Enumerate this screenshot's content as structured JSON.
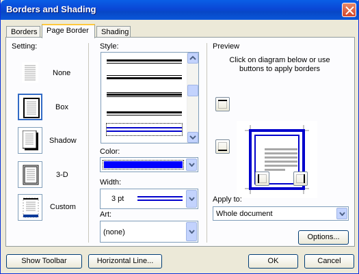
{
  "window": {
    "title": "Borders and Shading"
  },
  "tabs": [
    {
      "label": "Borders",
      "active": false
    },
    {
      "label": "Page Border",
      "active": true
    },
    {
      "label": "Shading",
      "active": false
    }
  ],
  "setting": {
    "label": "Setting:",
    "options": [
      {
        "label": "None",
        "icon": "page-none-icon",
        "selected": false
      },
      {
        "label": "Box",
        "icon": "page-box-icon",
        "selected": true
      },
      {
        "label": "Shadow",
        "icon": "page-shadow-icon",
        "selected": false
      },
      {
        "label": "3-D",
        "icon": "page-3d-icon",
        "selected": false
      },
      {
        "label": "Custom",
        "icon": "page-custom-icon",
        "selected": false
      }
    ]
  },
  "style": {
    "label": "Style:",
    "items": [
      "thick-thin double",
      "thin-thick double",
      "thick-thin-thick triple",
      "thick-thin double",
      "thin-thin double (blue, selected)"
    ]
  },
  "color": {
    "label": "Color:",
    "value_color": "#0000ff"
  },
  "width": {
    "label": "Width:",
    "value": "3 pt"
  },
  "art": {
    "label": "Art:",
    "value": "(none)"
  },
  "preview": {
    "label": "Preview",
    "hint": "Click on diagram below or use buttons to apply borders",
    "border_color": "#0000cc"
  },
  "apply_to": {
    "label": "Apply to:",
    "value": "Whole document"
  },
  "buttons": {
    "options": "Options...",
    "show_toolbar": "Show Toolbar",
    "horizontal_line": "Horizontal Line...",
    "ok": "OK",
    "cancel": "Cancel"
  }
}
